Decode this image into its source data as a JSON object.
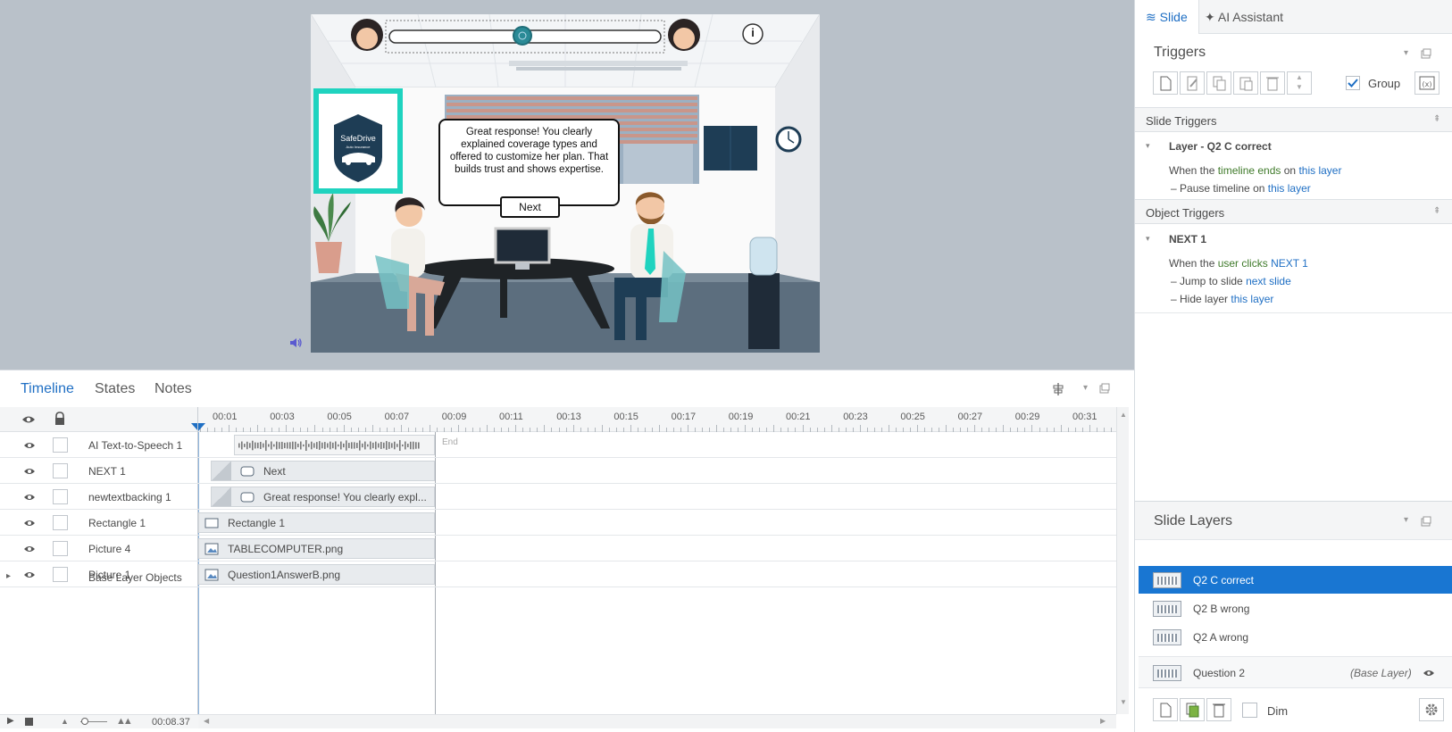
{
  "timeline_tabs": [
    "Timeline",
    "States",
    "Notes"
  ],
  "timeline": {
    "ticks": [
      "00:01",
      "00:03",
      "00:05",
      "00:07",
      "00:09",
      "00:11",
      "00:13",
      "00:15",
      "00:17",
      "00:19",
      "00:21",
      "00:23",
      "00:25",
      "00:27",
      "00:29",
      "00:31"
    ],
    "end_label": "End",
    "rows": [
      {
        "name": "AI Text-to-Speech 1",
        "bar_label": ""
      },
      {
        "name": "NEXT 1",
        "bar_label": "Next"
      },
      {
        "name": "newtextbacking 1",
        "bar_label": "Great response! You clearly expl..."
      },
      {
        "name": "Rectangle 1",
        "bar_label": "Rectangle 1"
      },
      {
        "name": "Picture 4",
        "bar_label": "TABLECOMPUTER.png"
      },
      {
        "name": "Picture 1",
        "bar_label": "Question1AnswerB.png"
      }
    ],
    "base_layer_label": "Base Layer Objects",
    "time_readout": "00:08.37"
  },
  "slide": {
    "speech_text": "Great response! You clearly explained coverage types and offered to customize her plan. That builds trust and shows expertise.",
    "next_button": "Next",
    "logo_name": "SafeDrive",
    "logo_sub": "Auto Insurance",
    "info_glyph": "i"
  },
  "right": {
    "tabs": [
      "Slide",
      "AI Assistant"
    ],
    "triggers_title": "Triggers",
    "group_label": "Group",
    "slide_triggers_header": "Slide Triggers",
    "layer_group": "Layer - Q2 C correct",
    "slide_trigger_when": [
      "When the ",
      "timeline ends",
      " on ",
      "this layer"
    ],
    "slide_trigger_action": [
      "Pause timeline",
      " on ",
      "this layer"
    ],
    "object_triggers_header": "Object Triggers",
    "object_group": "NEXT 1",
    "object_trigger_when": [
      "When the ",
      "user clicks",
      " ",
      "NEXT 1"
    ],
    "object_action_1": [
      "Jump to slide",
      " ",
      "next slide"
    ],
    "object_action_2": [
      "Hide layer",
      " ",
      "this layer"
    ],
    "slide_layers_title": "Slide Layers",
    "layers": [
      {
        "name": "Q2 C correct",
        "selected": true
      },
      {
        "name": "Q2 B wrong",
        "selected": false
      },
      {
        "name": "Q2 A wrong",
        "selected": false
      }
    ],
    "base_layer": {
      "name": "Question 2",
      "tag": "(Base Layer)"
    },
    "dim_label": "Dim"
  },
  "colors": {
    "accent": "#1976d2",
    "teal": "#1fd3bf",
    "stage_bg": "#b9c1c9"
  }
}
